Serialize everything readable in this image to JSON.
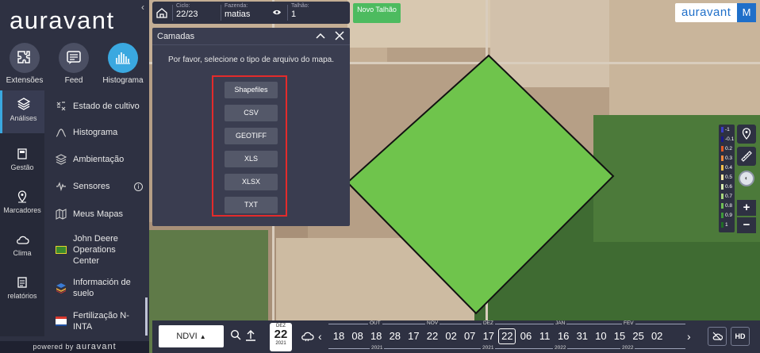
{
  "sidebar": {
    "logo": "auravant",
    "top_items": [
      {
        "label": "Extensões",
        "icon": "puzzle-icon"
      },
      {
        "label": "Feed",
        "icon": "feed-icon"
      },
      {
        "label": "Histograma",
        "icon": "histogram-icon"
      }
    ],
    "rail_items": [
      {
        "label": "Análises",
        "icon": "layers-icon",
        "active": true
      },
      {
        "label": "Gestão",
        "icon": "clipboard-icon"
      },
      {
        "label": "Marcadores",
        "icon": "marker-icon"
      },
      {
        "label": "Clima",
        "icon": "cloud-icon"
      },
      {
        "label": "relatórios",
        "icon": "report-icon"
      }
    ],
    "menu_items": [
      {
        "label": "Estado de cultivo",
        "icon": "crop-state-icon"
      },
      {
        "label": "Histograma",
        "icon": "histogram-line-icon"
      },
      {
        "label": "Ambientação",
        "icon": "stack-icon"
      },
      {
        "label": "Sensores",
        "icon": "sensor-wave-icon",
        "info": "i"
      },
      {
        "label": "Meus Mapas",
        "icon": "map-icon"
      },
      {
        "label": "John Deere Operations Center",
        "icon": "john-deere-icon"
      },
      {
        "label": "Información de suelo",
        "icon": "soil-info-icon"
      },
      {
        "label": "Fertilização N-INTA",
        "icon": "inta-icon"
      }
    ],
    "powered_prefix": "powered by",
    "powered_brand": "auravant"
  },
  "topbar": {
    "ciclo_caption": "Ciclo:",
    "ciclo_value": "22/23",
    "fazenda_caption": "Fazenda:",
    "fazenda_value": "matias",
    "talhao_caption": "Talhão:",
    "talhao_value": "1",
    "novo_talhao": "Novo Talhão"
  },
  "brand": {
    "logo": "auravant",
    "avatar": "M",
    "colors": {
      "brand": "#1f6fc9"
    }
  },
  "dialog": {
    "title": "Camadas",
    "message": "Por favor, selecione o tipo de arquivo do mapa.",
    "file_types": [
      "Shapefiles",
      "CSV",
      "GEOTIFF",
      "XLS",
      "XLSX",
      "TXT"
    ]
  },
  "legend": [
    {
      "label": "-1",
      "color": "#3a3dc8"
    },
    {
      "label": "-0.1",
      "color": "#1a1a8c"
    },
    {
      "label": "0.2",
      "color": "#e45a24"
    },
    {
      "label": "0.3",
      "color": "#f08a3c"
    },
    {
      "label": "0.4",
      "color": "#f5c04a"
    },
    {
      "label": "0.5",
      "color": "#f7e7a6"
    },
    {
      "label": "0.6",
      "color": "#d9ecb0"
    },
    {
      "label": "0.7",
      "color": "#a6d67c"
    },
    {
      "label": "0.8",
      "color": "#6fbf55"
    },
    {
      "label": "0.9",
      "color": "#3e9a3a"
    },
    {
      "label": "1",
      "color": "#1f6e25"
    }
  ],
  "zoom": {
    "in": "+",
    "out": "−"
  },
  "timeline": {
    "layer_select": "NDVI",
    "selected_date": {
      "month": "DEZ",
      "day": "22",
      "year": "2021"
    },
    "months": [
      "OUT",
      "NOV",
      "DEZ",
      "JAN",
      "FEV"
    ],
    "years": [
      "2021",
      "2021",
      "2022",
      "2022"
    ],
    "days": [
      "18",
      "08",
      "18",
      "28",
      "17",
      "22",
      "02",
      "07",
      "17",
      "22",
      "06",
      "11",
      "16",
      "31",
      "10",
      "15",
      "25",
      "02"
    ],
    "selected_index": 9,
    "hd": "HD"
  }
}
